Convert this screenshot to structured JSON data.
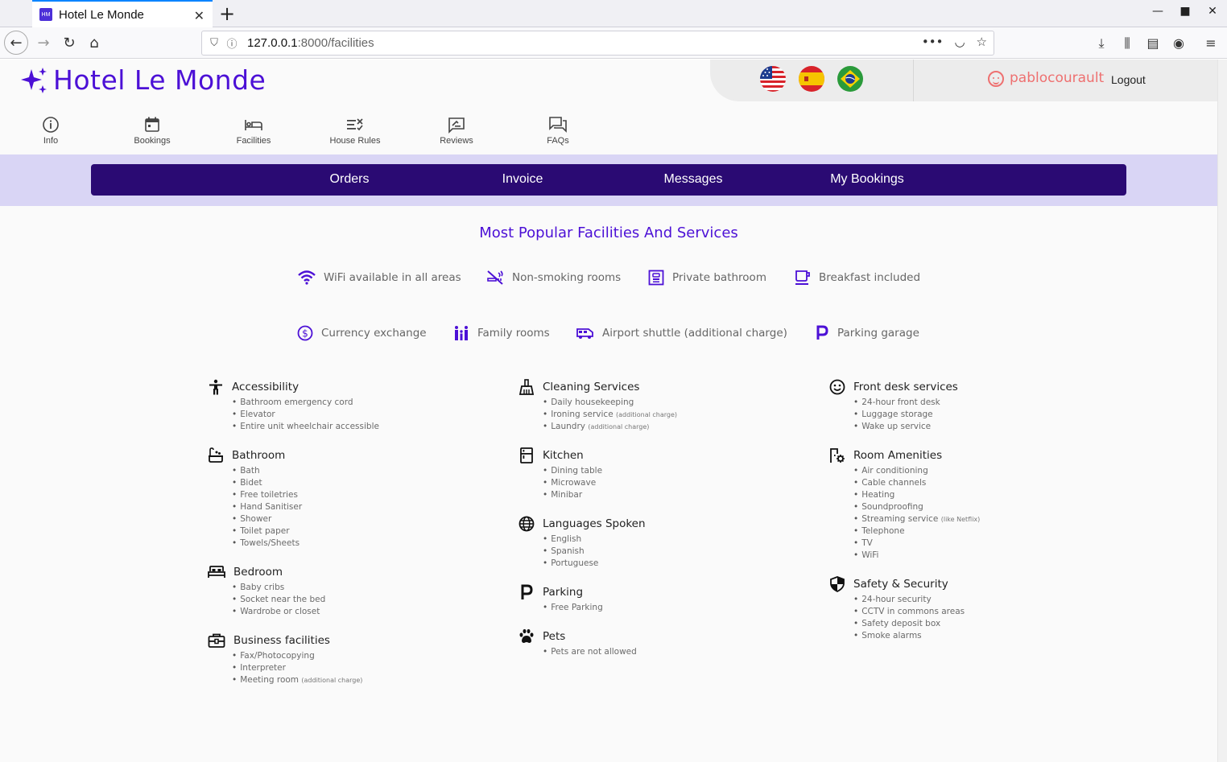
{
  "browser": {
    "tab_title": "Hotel Le Monde",
    "tab_favicon": "HM",
    "url_host": "127.0.0.1",
    "url_rest": ":8000/facilities"
  },
  "header": {
    "logo_text": "Hotel Le Monde",
    "username": "pablocourault",
    "logout": "Logout"
  },
  "colors": {
    "brand": "#4c10d6",
    "subnav_bg": "#2a0a73",
    "band_bg": "#d9d5f5",
    "user": "#ee7070"
  },
  "main_nav": [
    {
      "label": "Info",
      "icon": "info-icon"
    },
    {
      "label": "Bookings",
      "icon": "calendar-icon"
    },
    {
      "label": "Facilities",
      "icon": "bed-icon"
    },
    {
      "label": "House Rules",
      "icon": "rules-icon"
    },
    {
      "label": "Reviews",
      "icon": "review-icon"
    },
    {
      "label": "FAQs",
      "icon": "chat-icon"
    }
  ],
  "sub_nav": [
    "Orders",
    "Invoice",
    "Messages",
    "My Bookings"
  ],
  "popular": {
    "title": "Most Popular Facilities And Services",
    "items": [
      {
        "label": "WiFi available in all areas",
        "icon": "wifi-icon"
      },
      {
        "label": "Non-smoking rooms",
        "icon": "no-smoking-icon"
      },
      {
        "label": "Private bathroom",
        "icon": "bathroom-icon"
      },
      {
        "label": "Breakfast included",
        "icon": "coffee-icon"
      },
      {
        "label": "Currency exchange",
        "icon": "currency-icon"
      },
      {
        "label": "Family rooms",
        "icon": "family-icon"
      },
      {
        "label": "Airport shuttle (additional charge)",
        "icon": "shuttle-icon"
      },
      {
        "label": "Parking garage",
        "icon": "parking-icon"
      }
    ]
  },
  "categories": {
    "accessibility": {
      "title": "Accessibility",
      "icon": "accessibility-icon",
      "items": [
        "Bathroom emergency cord",
        "Elevator",
        "Entire unit wheelchair accessible"
      ]
    },
    "bathroom": {
      "title": "Bathroom",
      "icon": "bathtub-icon",
      "items": [
        "Bath",
        "Bidet",
        "Free toiletries",
        "Hand Sanitiser",
        "Shower",
        "Toilet paper",
        "Towels/Sheets"
      ]
    },
    "bedroom": {
      "title": "Bedroom",
      "icon": "bed-icon",
      "items": [
        "Baby cribs",
        "Socket near the bed",
        "Wardrobe or closet"
      ]
    },
    "business": {
      "title": "Business facilities",
      "icon": "briefcase-icon",
      "items": [
        "Fax/Photocopying",
        "Interpreter",
        "Meeting room"
      ],
      "note": "(additional charge)"
    },
    "cleaning": {
      "title": "Cleaning Services",
      "icon": "broom-icon",
      "items": [
        "Daily housekeeping",
        "Ironing service",
        "Laundry"
      ],
      "note": "(additional charge)"
    },
    "kitchen": {
      "title": "Kitchen",
      "icon": "fridge-icon",
      "items": [
        "Dining table",
        "Microwave",
        "Minibar"
      ]
    },
    "languages": {
      "title": "Languages Spoken",
      "icon": "globe-icon",
      "items": [
        "English",
        "Spanish",
        "Portuguese"
      ]
    },
    "parking": {
      "title": "Parking",
      "icon": "parking-icon",
      "items": [
        "Free Parking"
      ]
    },
    "pets": {
      "title": "Pets",
      "icon": "paw-icon",
      "items": [
        "Pets are not allowed"
      ]
    },
    "frontdesk": {
      "title": "Front desk services",
      "icon": "smile-icon",
      "items": [
        "24-hour front desk",
        "Luggage storage",
        "Wake up service"
      ]
    },
    "room": {
      "title": "Room Amenities",
      "icon": "room-settings-icon",
      "items": [
        "Air conditioning",
        "Cable channels",
        "Heating",
        "Soundproofing",
        "Streaming service",
        "Telephone",
        "TV",
        "WiFi"
      ],
      "note_streaming": "(like Netflix)"
    },
    "safety": {
      "title": "Safety & Security",
      "icon": "shield-icon",
      "items": [
        "24-hour security",
        "CCTV in commons areas",
        "Safety deposit box",
        "Smoke alarms"
      ]
    }
  }
}
